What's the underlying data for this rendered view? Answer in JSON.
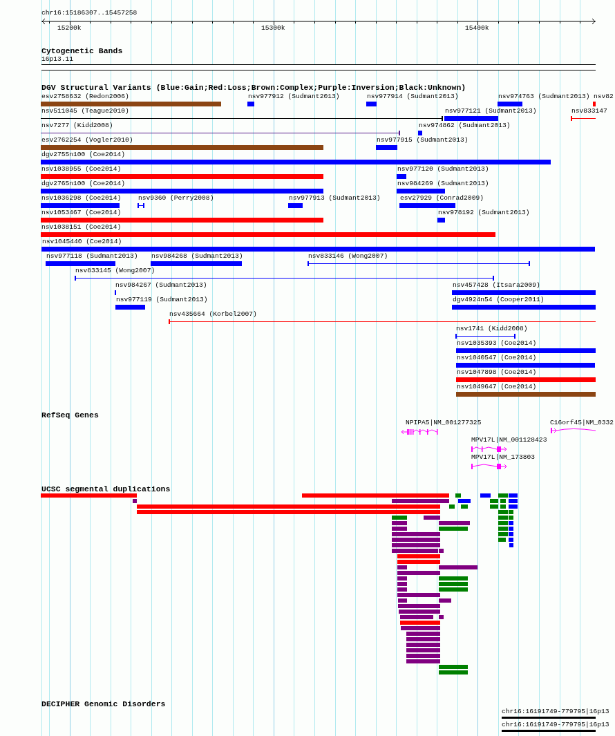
{
  "ruler": {
    "location": "chr16:15186307..15457258",
    "ticks": [
      "15200k",
      "15300k",
      "15400k"
    ]
  },
  "tracks": [
    {
      "kind": "bands",
      "title": "Cytogenetic Bands",
      "bands": [
        {
          "label": "16p13.11"
        }
      ]
    },
    {
      "kind": "variants",
      "title": "DGV Structural Variants (Blue:Gain;Red:Loss;Brown:Complex;Purple:Inversion;Black:Unknown)",
      "features": [
        {
          "label": "esv2758632 (Redon2006)",
          "color": "#8b4513",
          "kind": "bar"
        },
        {
          "label": "nsv977912 (Sudmant2013)",
          "color": "#0000ff",
          "kind": "bar"
        },
        {
          "label": "nsv977914 (Sudmant2013)",
          "color": "#0000ff",
          "kind": "bar"
        },
        {
          "label": "nsv974763 (Sudmant2013)",
          "color": "#0000ff",
          "kind": "bar"
        },
        {
          "label": "nsv82",
          "color": "#ff0000",
          "kind": "bar"
        },
        {
          "label": "nsv511045 (Teague2010)",
          "color": "#000000",
          "kind": "span"
        },
        {
          "label": "nsv977121 (Sudmant2013)",
          "color": "#0000ff",
          "kind": "bar"
        },
        {
          "label": "nsv833147",
          "color": "#ff0000",
          "kind": "span"
        },
        {
          "label": "nsv7277 (Kidd2008)",
          "color": "#551a8b",
          "kind": "span"
        },
        {
          "label": "nsv974862 (Sudmant2013)",
          "color": "#0000ff",
          "kind": "bar"
        },
        {
          "label": "esv2762254 (Vogler2010)",
          "color": "#8b4513",
          "kind": "bar"
        },
        {
          "label": "nsv977915 (Sudmant2013)",
          "color": "#0000ff",
          "kind": "bar"
        },
        {
          "label": "dgv2755n100 (Coe2014)",
          "color": "#0000ff",
          "kind": "bar"
        },
        {
          "label": "nsv1038955 (Coe2014)",
          "color": "#ff0000",
          "kind": "bar"
        },
        {
          "label": "nsv977120 (Sudmant2013)",
          "color": "#0000ff",
          "kind": "bar"
        },
        {
          "label": "dgv2765n100 (Coe2014)",
          "color": "#0000ff",
          "kind": "bar"
        },
        {
          "label": "nsv984269 (Sudmant2013)",
          "color": "#0000ff",
          "kind": "bar"
        },
        {
          "label": "nsv1036298 (Coe2014)",
          "color": "#0000ff",
          "kind": "bar"
        },
        {
          "label": "nsv9360 (Perry2008)",
          "color": "#0000ff",
          "kind": "span"
        },
        {
          "label": "nsv977913 (Sudmant2013)",
          "color": "#0000ff",
          "kind": "bar"
        },
        {
          "label": "esv27929 (Conrad2009)",
          "color": "#0000ff",
          "kind": "bar"
        },
        {
          "label": "nsv1053467 (Coe2014)",
          "color": "#ff0000",
          "kind": "bar"
        },
        {
          "label": "nsv978192 (Sudmant2013)",
          "color": "#0000ff",
          "kind": "bar"
        },
        {
          "label": "nsv1038151 (Coe2014)",
          "color": "#ff0000",
          "kind": "bar"
        },
        {
          "label": "nsv1045440 (Coe2014)",
          "color": "#0000ff",
          "kind": "bar"
        },
        {
          "label": "nsv977118 (Sudmant2013)",
          "color": "#0000ff",
          "kind": "bar"
        },
        {
          "label": "nsv984268 (Sudmant2013)",
          "color": "#0000ff",
          "kind": "bar"
        },
        {
          "label": "nsv833146 (Wong2007)",
          "color": "#0000ff",
          "kind": "span"
        },
        {
          "label": "nsv833145 (Wong2007)",
          "color": "#0000ff",
          "kind": "span"
        },
        {
          "label": "nsv984267 (Sudmant2013)",
          "color": "#0000ff",
          "kind": "bar"
        },
        {
          "label": "nsv457428 (Itsara2009)",
          "color": "#0000ff",
          "kind": "bar"
        },
        {
          "label": "nsv977119 (Sudmant2013)",
          "color": "#0000ff",
          "kind": "bar"
        },
        {
          "label": "dgv4924n54 (Cooper2011)",
          "color": "#0000ff",
          "kind": "bar"
        },
        {
          "label": "nsv435664 (Korbel2007)",
          "color": "#ff0000",
          "kind": "span"
        },
        {
          "label": "nsv1741 (Kidd2008)",
          "color": "#0000ff",
          "kind": "span"
        },
        {
          "label": "nsv1035393 (Coe2014)",
          "color": "#0000ff",
          "kind": "bar"
        },
        {
          "label": "nsv1040547 (Coe2014)",
          "color": "#0000ff",
          "kind": "bar"
        },
        {
          "label": "nsv1047898 (Coe2014)",
          "color": "#ff0000",
          "kind": "bar"
        },
        {
          "label": "nsv1049647 (Coe2014)",
          "color": "#8b4513",
          "kind": "bar"
        }
      ]
    },
    {
      "kind": "genes",
      "title": "RefSeq Genes",
      "features": [
        {
          "label": "NPIPA5|NM_001277325"
        },
        {
          "label": "C16orf45|NM_0332"
        },
        {
          "label": "MPV17L|NM_001128423"
        },
        {
          "label": "MPV17L|NM_173803"
        }
      ]
    },
    {
      "kind": "segdups",
      "title": "UCSC segmental duplications",
      "bars": [
        {
          "color": "#ff0000"
        },
        {
          "color": "#ff0000"
        },
        {
          "color": "#008000"
        },
        {
          "color": "#0000ff"
        },
        {
          "color": "#008000"
        },
        {
          "color": "#0000ff"
        },
        {
          "color": "#800080"
        },
        {
          "color": "#800080"
        },
        {
          "color": "#0000ff"
        },
        {
          "color": "#008000"
        },
        {
          "color": "#008000"
        },
        {
          "color": "#0000ff"
        },
        {
          "color": "#ff0000"
        },
        {
          "color": "#008000"
        },
        {
          "color": "#008000"
        },
        {
          "color": "#008000"
        },
        {
          "color": "#008000"
        },
        {
          "color": "#0000ff"
        },
        {
          "color": "#ff0000"
        },
        {
          "color": "#008000"
        },
        {
          "color": "#008000"
        },
        {
          "color": "#008000"
        },
        {
          "color": "#800080"
        },
        {
          "color": "#008000"
        },
        {
          "color": "#008000"
        },
        {
          "color": "#800080"
        },
        {
          "color": "#800080"
        },
        {
          "color": "#008000"
        },
        {
          "color": "#0000ff"
        },
        {
          "color": "#800080"
        },
        {
          "color": "#008000"
        },
        {
          "color": "#008000"
        },
        {
          "color": "#0000ff"
        },
        {
          "color": "#800080"
        },
        {
          "color": "#008000"
        },
        {
          "color": "#0000ff"
        },
        {
          "color": "#800080"
        },
        {
          "color": "#008000"
        },
        {
          "color": "#0000ff"
        },
        {
          "color": "#800080"
        },
        {
          "color": "#0000ff"
        },
        {
          "color": "#800080"
        },
        {
          "color": "#800080"
        },
        {
          "color": "#ff0000"
        },
        {
          "color": "#ff0000"
        },
        {
          "color": "#800080"
        },
        {
          "color": "#800080"
        },
        {
          "color": "#800080"
        },
        {
          "color": "#800080"
        },
        {
          "color": "#008000"
        },
        {
          "color": "#800080"
        },
        {
          "color": "#008000"
        },
        {
          "color": "#800080"
        },
        {
          "color": "#008000"
        },
        {
          "color": "#800080"
        },
        {
          "color": "#800080"
        },
        {
          "color": "#800080"
        },
        {
          "color": "#800080"
        },
        {
          "color": "#800080"
        },
        {
          "color": "#800080"
        },
        {
          "color": "#800080"
        },
        {
          "color": "#ff0000"
        },
        {
          "color": "#800080"
        },
        {
          "color": "#800080"
        },
        {
          "color": "#800080"
        },
        {
          "color": "#800080"
        },
        {
          "color": "#800080"
        },
        {
          "color": "#800080"
        },
        {
          "color": "#800080"
        },
        {
          "color": "#008000"
        },
        {
          "color": "#008000"
        }
      ]
    },
    {
      "kind": "decipher",
      "title": "DECIPHER Genomic Disorders",
      "features": [
        {
          "label": "chr16:16191749-779795|16p13"
        },
        {
          "label": "chr16:16191749-779795|16p13"
        }
      ]
    }
  ]
}
